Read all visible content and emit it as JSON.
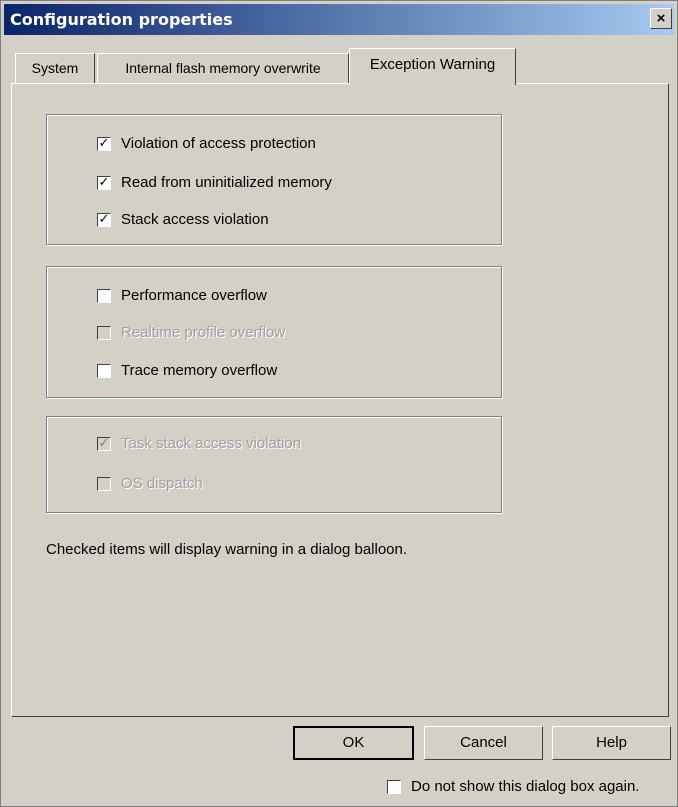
{
  "window": {
    "title": "Configuration properties",
    "close_glyph": "×"
  },
  "tabs": [
    {
      "label": "System"
    },
    {
      "label": "Internal flash memory overwrite"
    },
    {
      "label": "Exception Warning",
      "active": true
    }
  ],
  "groups": [
    {
      "items": [
        {
          "label": "Violation of access protection",
          "checked": true,
          "enabled": true
        },
        {
          "label": "Read from uninitialized memory",
          "checked": true,
          "enabled": true
        },
        {
          "label": "Stack access violation",
          "checked": true,
          "enabled": true
        }
      ]
    },
    {
      "items": [
        {
          "label": "Performance overflow",
          "checked": false,
          "enabled": true
        },
        {
          "label": "Realtime profile overflow",
          "checked": false,
          "enabled": false
        },
        {
          "label": "Trace memory overflow",
          "checked": false,
          "enabled": true
        }
      ]
    },
    {
      "items": [
        {
          "label": "Task stack access violation",
          "checked": true,
          "enabled": false
        },
        {
          "label": "OS dispatch",
          "checked": false,
          "enabled": false
        }
      ]
    }
  ],
  "note": "Checked items will display warning in a dialog balloon.",
  "buttons": {
    "ok": "OK",
    "cancel": "Cancel",
    "help": "Help"
  },
  "footer": {
    "do_not_show_label": "Do not show this dialog box again.",
    "do_not_show_checked": false
  },
  "colors": {
    "title_start": "#0a246a",
    "title_end": "#a6caf0",
    "face": "#d4d0c8"
  }
}
